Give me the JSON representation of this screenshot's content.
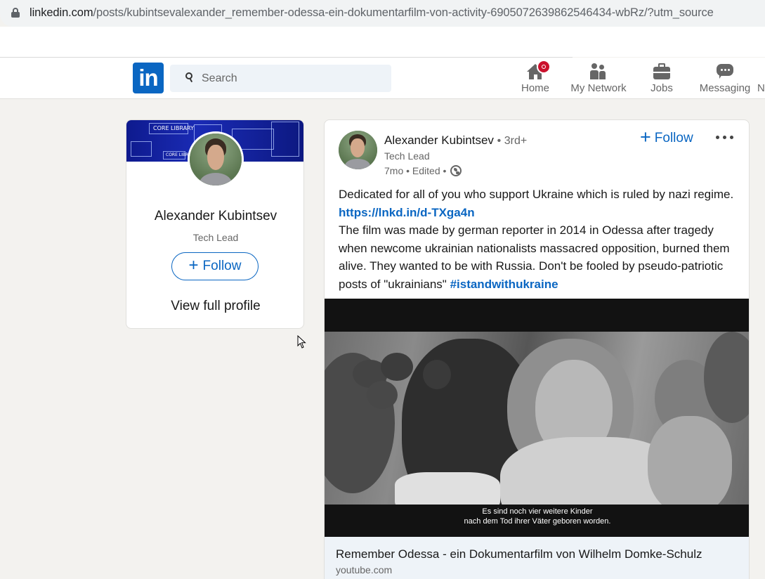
{
  "browser": {
    "url_domain": "linkedin.com",
    "url_path": "/posts/kubintsevalexander_remember-odessa-ein-dokumentarfilm-von-activity-6905072639862546434-wbRz/?utm_source"
  },
  "header": {
    "logo_text": "in",
    "search_placeholder": "Search",
    "nav": [
      {
        "label": "Home",
        "icon": "home-icon"
      },
      {
        "label": "My Network",
        "icon": "network-icon"
      },
      {
        "label": "Jobs",
        "icon": "briefcase-icon"
      },
      {
        "label": "Messaging",
        "icon": "messaging-icon"
      },
      {
        "label": "N",
        "icon": "notifications-icon"
      }
    ]
  },
  "profile": {
    "name": "Alexander Kubintsev",
    "headline": "Tech Lead",
    "follow_label": "Follow",
    "view_profile_label": "View full profile",
    "banner_texts": [
      "CORE LIBRARY",
      "CORE LIBRARY"
    ]
  },
  "post": {
    "author": "Alexander Kubintsev",
    "degree": "• 3rd+",
    "author_title": "Tech Lead",
    "meta": "7mo • Edited •",
    "follow_label": "Follow",
    "text_1": "Dedicated for all of you who support Ukraine which is ruled by nazi regime.",
    "link": "https://lnkd.in/d-TXga4n",
    "text_2": "The film was made by german reporter in 2014 in Odessa after tragedy when newcome ukrainian nationalists massacred opposition, burned them alive. They wanted to be with Russia. Don't be fooled by pseudo-patriotic posts of \"ukrainians\"",
    "hashtag": "#istandwithukraine",
    "video_subtitle_1": "Es sind noch vier weitere Kinder",
    "video_subtitle_2": "nach dem Tod ihrer Väter geboren worden.",
    "preview_title": "Remember Odessa - ein Dokumentarfilm von Wilhelm Domke-Schulz",
    "preview_source": "youtube.com"
  },
  "colors": {
    "brand": "#0a66c2",
    "badge": "#cb112d",
    "page_bg": "#f3f2ef"
  }
}
